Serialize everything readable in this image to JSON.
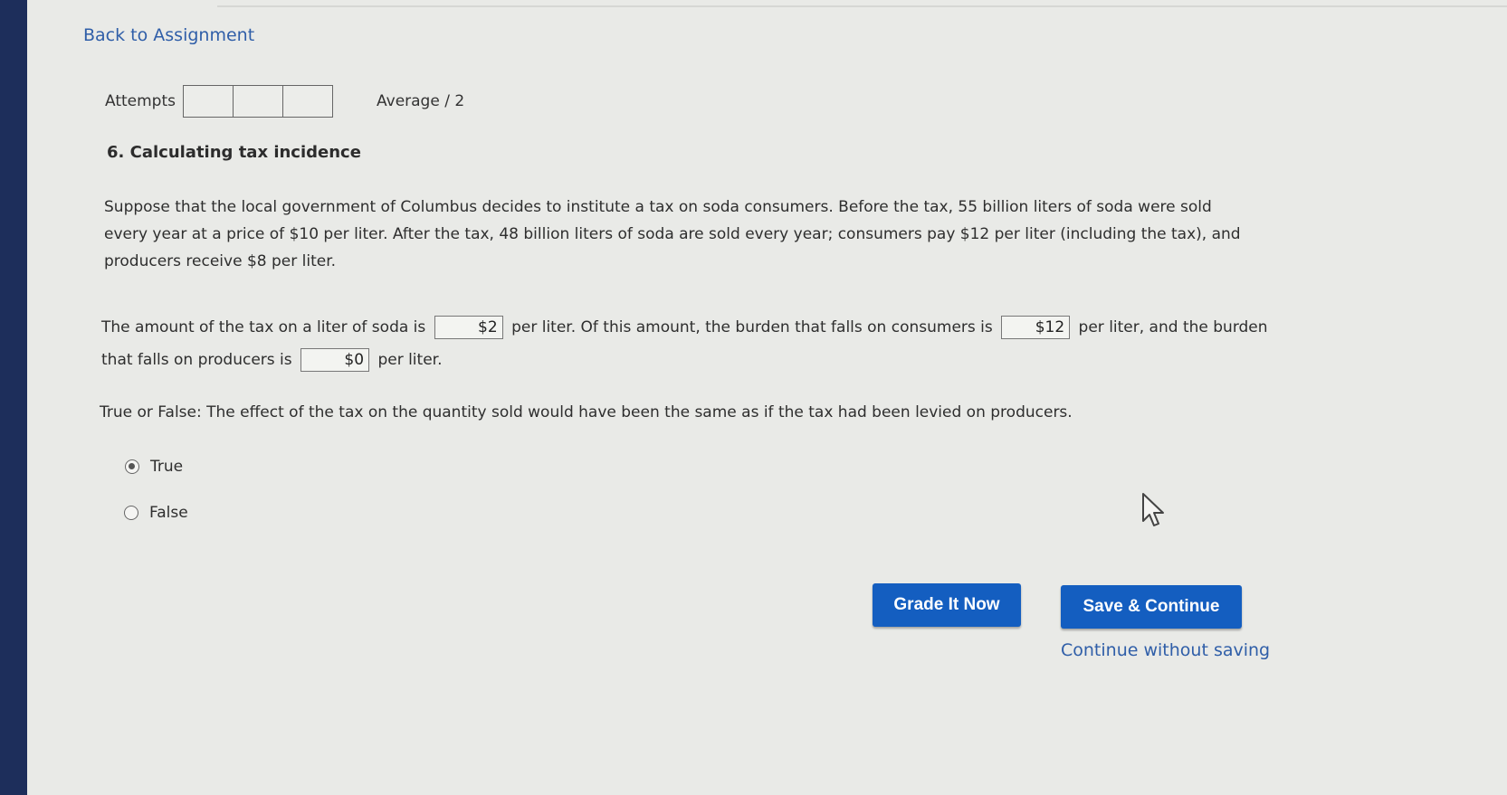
{
  "nav": {
    "back_label": "Back to Assignment"
  },
  "attempts": {
    "label": "Attempts",
    "average_label": "Average / 2"
  },
  "question": {
    "title": "6. Calculating tax incidence",
    "paragraph": "Suppose that the local government of Columbus decides to institute a tax on soda consumers. Before the tax, 55 billion liters of soda were sold every year at a price of $10 per liter. After the tax, 48 billion liters of soda are sold every year; consumers pay $12 per liter (including the tax), and producers receive $8 per liter.",
    "fill": {
      "part1": "The amount of the tax on a liter of soda is",
      "tax_value": "$2",
      "part2": "per liter. Of this amount, the burden that falls on consumers is",
      "consumer_value": "$12",
      "part3": "per liter, and the burden that falls on producers is",
      "producer_value": "$0",
      "part4": "per liter."
    },
    "tf_question": "True or False: The effect of the tax on the quantity sold would have been the same as if the tax had been levied on producers.",
    "options": {
      "true_label": "True",
      "false_label": "False",
      "selected": "True"
    }
  },
  "actions": {
    "grade_label": "Grade It Now",
    "save_label": "Save & Continue",
    "continue_label": "Continue without saving"
  }
}
